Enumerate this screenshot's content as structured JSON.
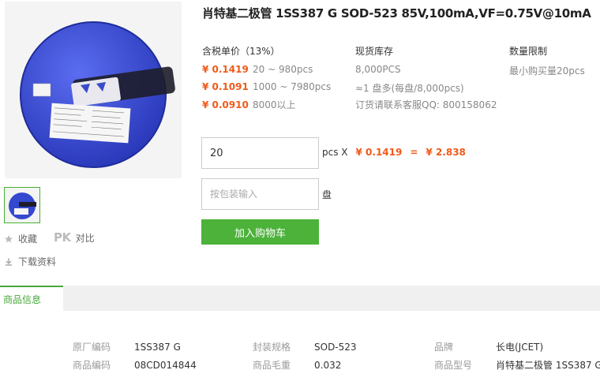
{
  "product": {
    "title": "肖特基二极管 1SS387 G SOD-523 85V,100mA,VF=0.75V@10mA"
  },
  "actions": {
    "favorite": "收藏",
    "pk_mark": "PK",
    "compare": "对比",
    "download": "下载资料"
  },
  "pricing": {
    "header": "含税单价（13%）",
    "tiers": [
      {
        "price": "¥ 0.1419",
        "range": "20 ~ 980pcs"
      },
      {
        "price": "¥ 0.1091",
        "range": "1000 ~ 7980pcs"
      },
      {
        "price": "¥ 0.0910",
        "range": "8000以上"
      }
    ]
  },
  "stock": {
    "header": "现货库存",
    "quantity": "8,000PCS",
    "reel": "≈1 盘多(每盘/8,000pcs)",
    "contact": "订货请联系客服QQ: 800158062"
  },
  "limit": {
    "header": "数量限制",
    "min": "最小购买量20pcs"
  },
  "order": {
    "qty_value": "20",
    "qty_unit": "pcs X",
    "unit_price": "¥ 0.1419",
    "equals": "=",
    "total": "¥ 2.838",
    "reel_placeholder": "按包装输入",
    "reel_unit": "盘",
    "add_to_cart": "加入购物车"
  },
  "tabs": {
    "active": "商品信息"
  },
  "info": {
    "rows": [
      [
        {
          "k": "原厂编码",
          "v": "1SS387 G"
        },
        {
          "k": "封装规格",
          "v": "SOD-523"
        },
        {
          "k": "品牌",
          "v": "长电(JCET)"
        }
      ],
      [
        {
          "k": "商品编码",
          "v": "08CD014844"
        },
        {
          "k": "商品毛重",
          "v": "0.032"
        },
        {
          "k": "商品型号",
          "v": "肖特基二极管 1SS387 G"
        }
      ]
    ]
  },
  "colors": {
    "accent_green": "#4cb23a",
    "price_orange": "#f05a1a",
    "reel_blue": "#3548d0"
  },
  "icons": {
    "favorite": "star-icon",
    "download": "download-icon"
  }
}
